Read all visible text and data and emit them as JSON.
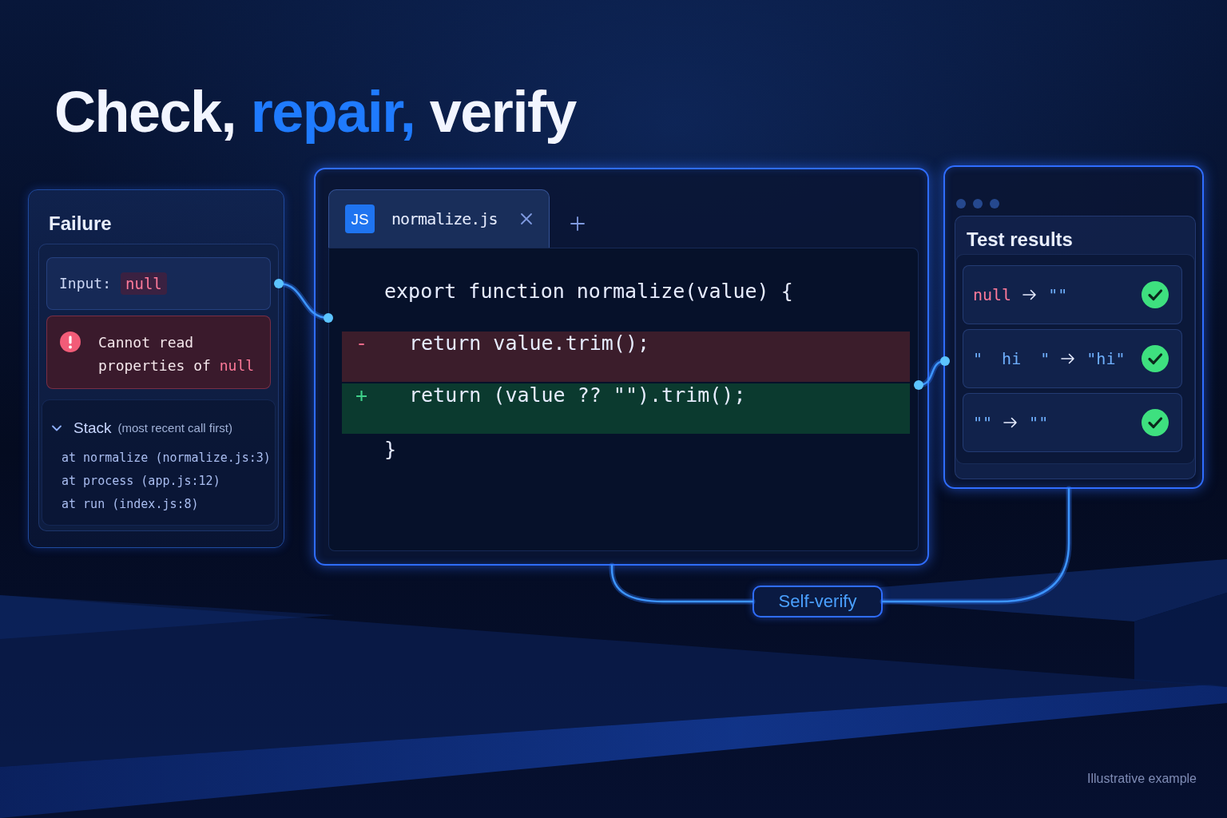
{
  "title": {
    "parts": [
      {
        "text": "Check,",
        "accent": false
      },
      {
        "text": "repair,",
        "accent": true
      },
      {
        "text": "verify",
        "accent": false
      }
    ]
  },
  "failure": {
    "title": "Failure",
    "input": {
      "label": "Input:",
      "value": "null"
    },
    "error": {
      "text": "Cannot read properties of",
      "value": "null"
    },
    "stack": {
      "title": "Stack",
      "note": "(most recent call first)",
      "expanded": true,
      "frames": [
        "at normalize (normalize.js:3)",
        "at process (app.js:12)",
        "at run (index.js:8)"
      ]
    }
  },
  "editor": {
    "tabs": [
      {
        "badge": "JS",
        "label": "normalize.js",
        "selected": true
      }
    ],
    "code": [
      {
        "kind": "context",
        "text": "export function normalize(value) {",
        "children": [
          {
            "kind": "removed",
            "marker": "-",
            "text": "return value.trim();"
          },
          {
            "kind": "added",
            "marker": "+",
            "text": "return (value ?? \"\").trim();"
          }
        ]
      },
      {
        "kind": "context",
        "text": "}"
      }
    ]
  },
  "tests": {
    "title": "Test results",
    "cases": [
      {
        "input": {
          "kind": "null",
          "text": "null"
        },
        "expected": "\"\"",
        "passed": true
      },
      {
        "input": {
          "kind": "string",
          "text": "\"  hi  \""
        },
        "expected": "\"hi\"",
        "passed": true
      },
      {
        "input": {
          "kind": "string",
          "text": "\"\""
        },
        "expected": "\"\"",
        "passed": true
      }
    ]
  },
  "loop_label": "Self-verify",
  "footnote": "Illustrative example"
}
